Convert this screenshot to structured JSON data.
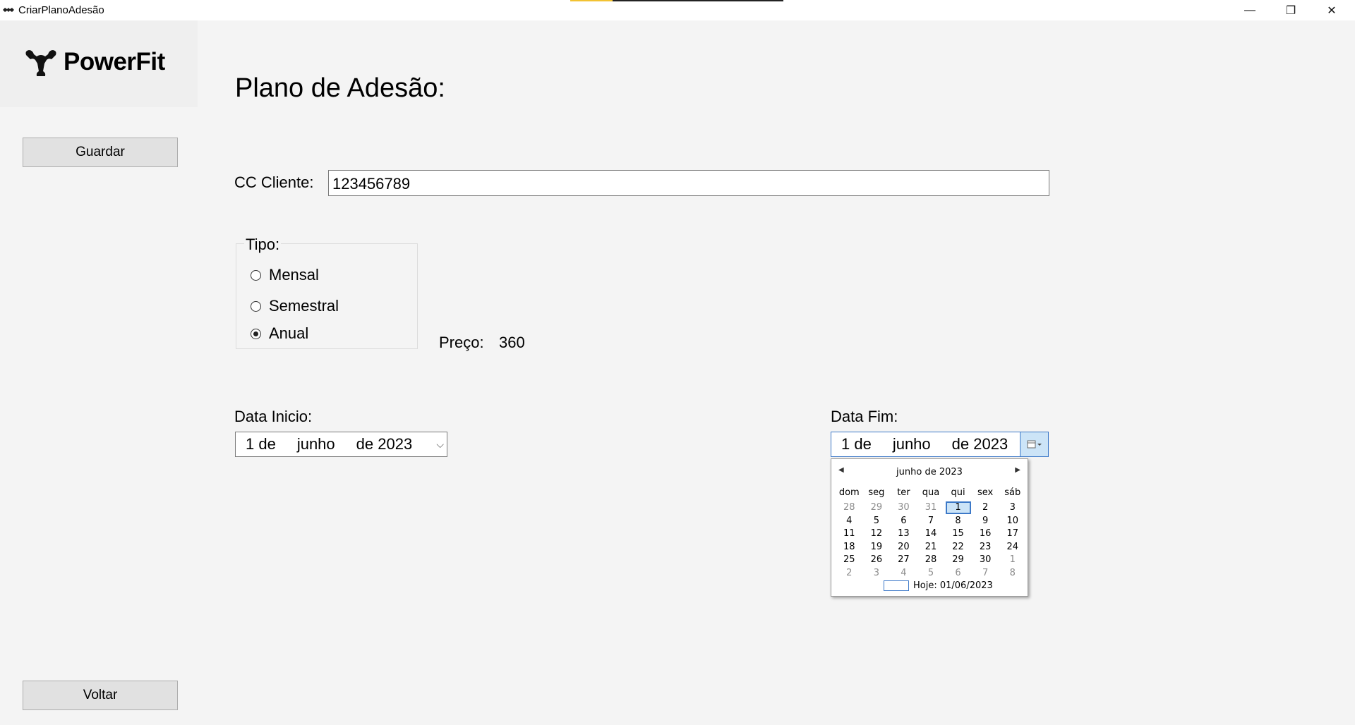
{
  "window": {
    "title": "CriarPlanoAdesão",
    "minimize_glyph": "—",
    "maximize_glyph": "❐",
    "close_glyph": "✕"
  },
  "logo": {
    "text": "PowerFit",
    "icon": "flexing-arm-icon"
  },
  "sidebar": {
    "save_label": "Guardar",
    "back_label": "Voltar"
  },
  "page": {
    "title": "Plano de Adesão:"
  },
  "form": {
    "cc_label": "CC Cliente:",
    "cc_value": "123456789",
    "tipo_label": "Tipo:",
    "tipo_options": [
      "Mensal",
      "Semestral",
      "Anual"
    ],
    "tipo_selected": "Anual",
    "price_label": "Preço:",
    "price_value": "360",
    "start_label": "Data Inicio:",
    "start_date": {
      "day": "1 de",
      "month": "junho",
      "year": "de 2023"
    },
    "end_label": "Data Fim:",
    "end_date": {
      "day": "1 de",
      "month": "junho",
      "year": "de 2023"
    }
  },
  "calendar": {
    "month_title": "junho de 2023",
    "weekdays": [
      "dom",
      "seg",
      "ter",
      "qua",
      "qui",
      "sex",
      "sáb"
    ],
    "days": [
      {
        "d": "28",
        "other": true
      },
      {
        "d": "29",
        "other": true
      },
      {
        "d": "30",
        "other": true
      },
      {
        "d": "31",
        "other": true
      },
      {
        "d": "1",
        "selected": true
      },
      {
        "d": "2"
      },
      {
        "d": "3"
      },
      {
        "d": "4"
      },
      {
        "d": "5"
      },
      {
        "d": "6"
      },
      {
        "d": "7"
      },
      {
        "d": "8"
      },
      {
        "d": "9"
      },
      {
        "d": "10"
      },
      {
        "d": "11"
      },
      {
        "d": "12"
      },
      {
        "d": "13"
      },
      {
        "d": "14"
      },
      {
        "d": "15"
      },
      {
        "d": "16"
      },
      {
        "d": "17"
      },
      {
        "d": "18"
      },
      {
        "d": "19"
      },
      {
        "d": "20"
      },
      {
        "d": "21"
      },
      {
        "d": "22"
      },
      {
        "d": "23"
      },
      {
        "d": "24"
      },
      {
        "d": "25"
      },
      {
        "d": "26"
      },
      {
        "d": "27"
      },
      {
        "d": "28"
      },
      {
        "d": "29"
      },
      {
        "d": "30"
      },
      {
        "d": "1",
        "other": true
      },
      {
        "d": "2",
        "other": true
      },
      {
        "d": "3",
        "other": true
      },
      {
        "d": "4",
        "other": true
      },
      {
        "d": "5",
        "other": true
      },
      {
        "d": "6",
        "other": true
      },
      {
        "d": "7",
        "other": true
      },
      {
        "d": "8",
        "other": true
      }
    ],
    "today_label": "Hoje: 01/06/2023"
  },
  "colors": {
    "accent": "#3d79c8",
    "background": "#f4f4f4",
    "titlebar_accent_yellow": "#f2c232"
  }
}
